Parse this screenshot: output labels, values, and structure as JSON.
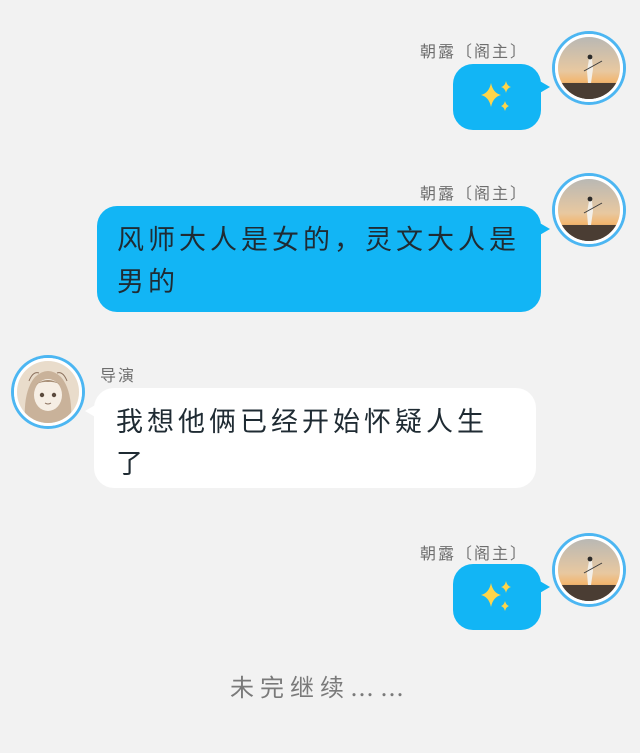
{
  "messages": [
    {
      "sender": "朝露〔阁主〕",
      "side": "right",
      "type": "emoji",
      "emoji": "sparkles-icon",
      "colors": {
        "bubble": "#12b5f5",
        "sparkle": "#ffd54a"
      }
    },
    {
      "sender": "朝露〔阁主〕",
      "side": "right",
      "type": "text",
      "text": "风师大人是女的，灵文大人是男的"
    },
    {
      "sender": "导演",
      "side": "left",
      "type": "text",
      "text": "我想他俩已经开始怀疑人生了"
    },
    {
      "sender": "朝露〔阁主〕",
      "side": "right",
      "type": "emoji",
      "emoji": "sparkles-icon"
    }
  ],
  "footer": "未完继续……",
  "colors": {
    "background": "#f2f2f2",
    "bubble_blue": "#12b5f5",
    "bubble_white": "#ffffff",
    "avatar_ring": "#4cb6f2"
  }
}
